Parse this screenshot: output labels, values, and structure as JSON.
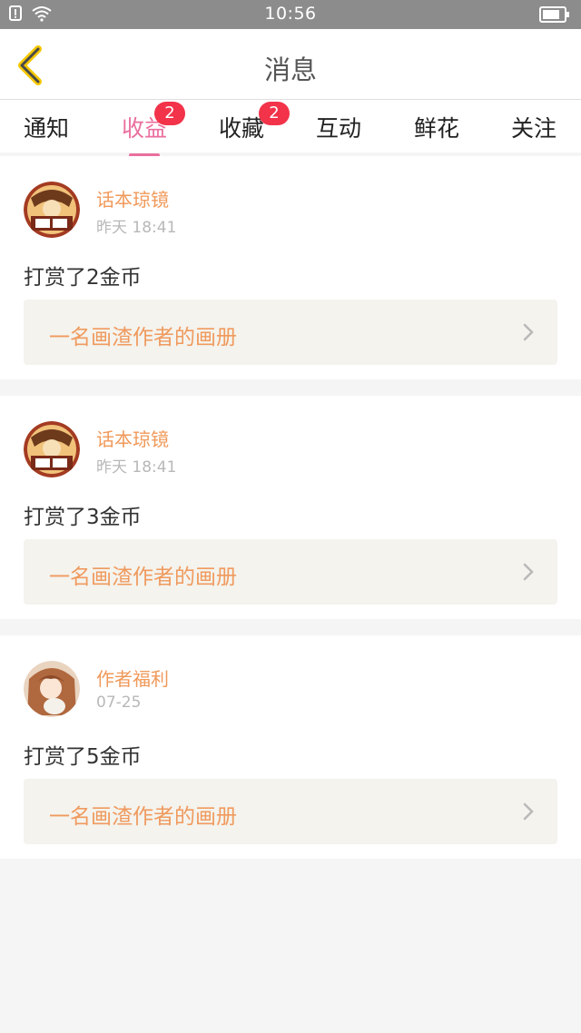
{
  "status_bar": {
    "time": "10:56"
  },
  "header": {
    "title": "消息"
  },
  "tabs": [
    {
      "label": "通知",
      "badge": ""
    },
    {
      "label": "收益",
      "badge": "2",
      "active": true
    },
    {
      "label": "收藏",
      "badge": "2"
    },
    {
      "label": "互动",
      "badge": ""
    },
    {
      "label": "鲜花",
      "badge": ""
    },
    {
      "label": "关注",
      "badge": ""
    }
  ],
  "messages": [
    {
      "sender": "话本琼镜",
      "time": "昨天 18:41",
      "text": "打赏了2金币",
      "link": "一名画渣作者的画册"
    },
    {
      "sender": "话本琼镜",
      "time": "昨天 18:41",
      "text": "打赏了3金币",
      "link": "一名画渣作者的画册"
    },
    {
      "sender": "作者福利",
      "time": "07-25",
      "text": "打赏了5金币",
      "link": "一名画渣作者的画册"
    }
  ],
  "colors": {
    "accent": "#ea6f9e",
    "badge": "#f2334a",
    "sender": "#f0995a",
    "link_text": "#f09a5e"
  }
}
